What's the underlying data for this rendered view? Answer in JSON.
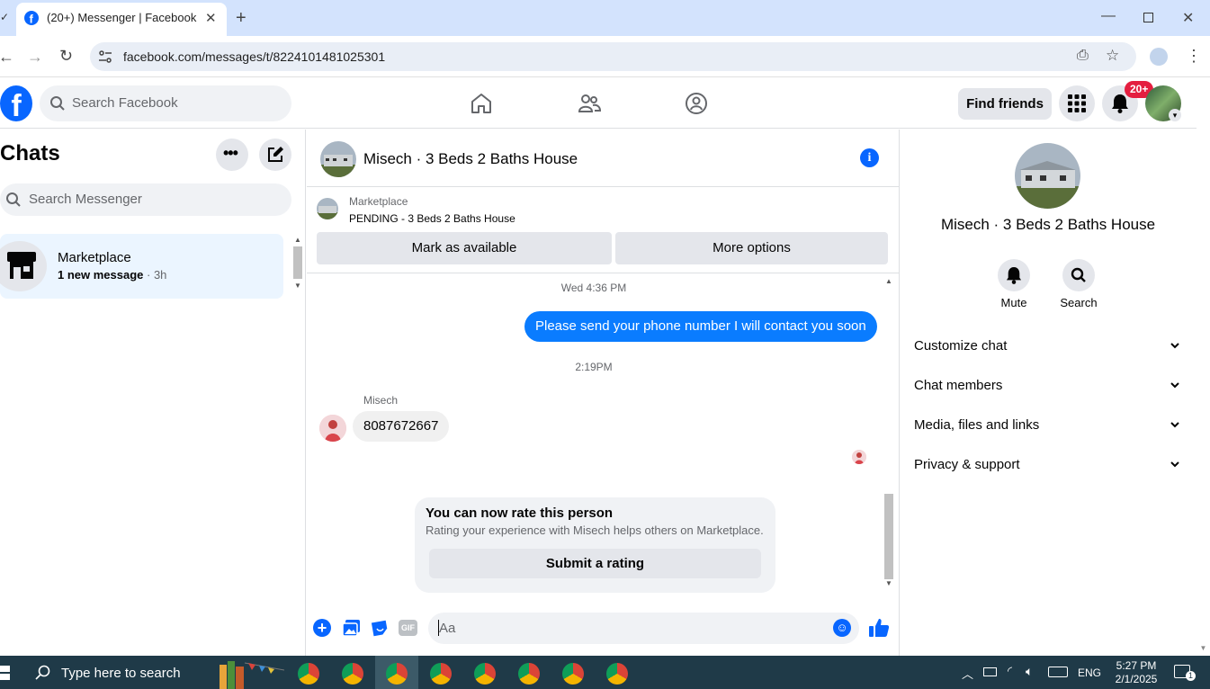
{
  "browser": {
    "tab_title": "(20+) Messenger | Facebook",
    "url": "facebook.com/messages/t/8224101481025301"
  },
  "header": {
    "search_placeholder": "Search Facebook",
    "find_friends": "Find friends",
    "notification_count": "20+"
  },
  "sidebar": {
    "title": "Chats",
    "search_placeholder": "Search Messenger",
    "chats": [
      {
        "name": "Marketplace",
        "preview": "1 new message",
        "time": "3h"
      }
    ]
  },
  "conversation": {
    "title": "Misech · 3 Beds 2 Baths House",
    "marketplace_label": "Marketplace",
    "listing_status": "PENDING - 3 Beds 2 Baths House",
    "mark_available": "Mark as available",
    "more_options": "More options",
    "messages": [
      {
        "timestamp": "Wed 4:36 PM",
        "text": "Please send your phone number I will contact you soon",
        "direction": "outgoing"
      },
      {
        "timestamp": "2:19PM",
        "sender": "Misech",
        "text": "8087672667",
        "direction": "incoming"
      }
    ],
    "rating_card": {
      "title": "You can now rate this person",
      "text": "Rating your experience with Misech helps others on Marketplace.",
      "button": "Submit a rating"
    },
    "composer_placeholder": "Aa"
  },
  "details": {
    "name": "Misech · 3 Beds 2 Baths House",
    "actions": [
      {
        "label": "Mute",
        "icon": "bell-icon"
      },
      {
        "label": "Search",
        "icon": "search-icon"
      }
    ],
    "sections": [
      "Customize chat",
      "Chat members",
      "Media, files and links",
      "Privacy & support"
    ]
  },
  "taskbar": {
    "search_placeholder": "Type here to search",
    "language": "ENG",
    "time": "5:27 PM",
    "date": "2/1/2025",
    "notification_count": "1"
  },
  "colors": {
    "accent": "#0866ff",
    "bubble_out": "#0a7cff",
    "badge": "#e41e3f"
  }
}
